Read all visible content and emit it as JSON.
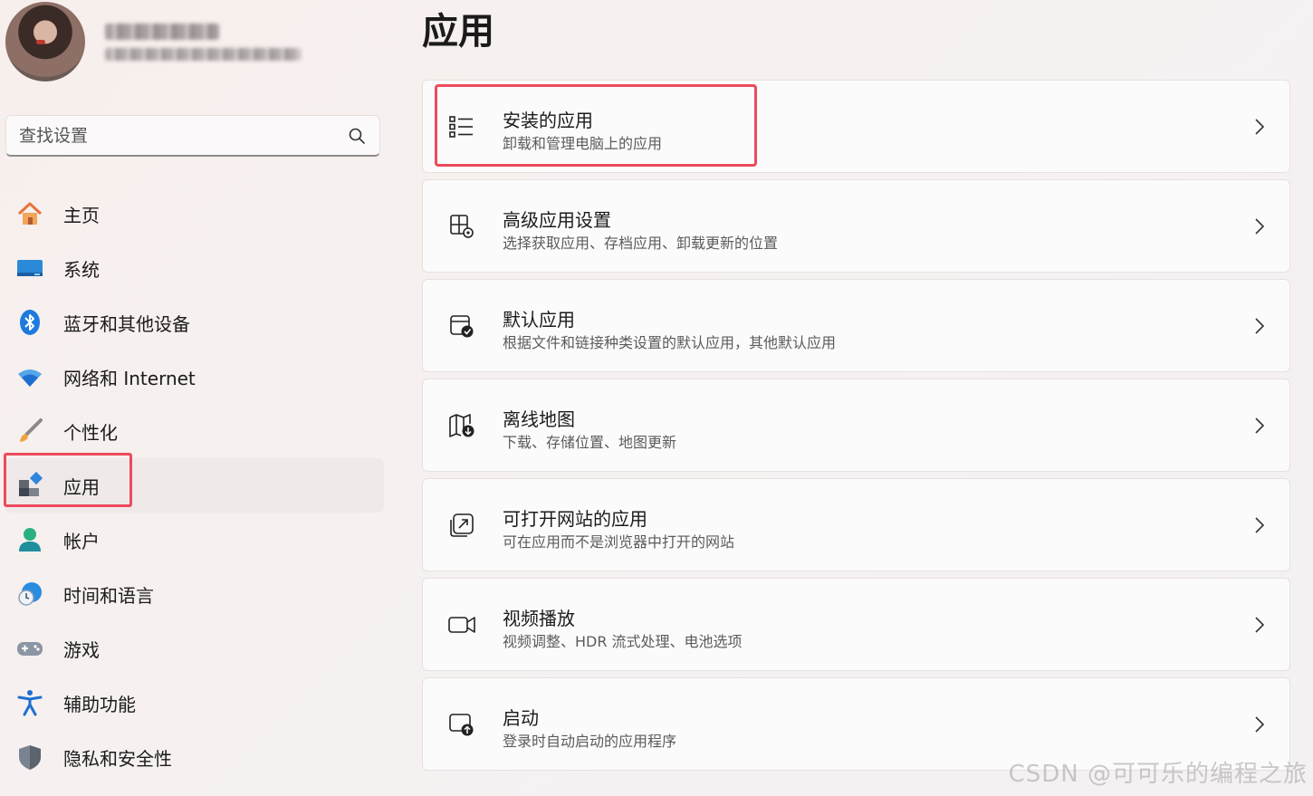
{
  "account": {
    "avatar_icon": "user-avatar-photo"
  },
  "search": {
    "placeholder": "查找设置",
    "icon": "search-icon"
  },
  "sidebar": {
    "items": [
      {
        "label": "主页",
        "icon": "home-icon"
      },
      {
        "label": "系统",
        "icon": "display-icon"
      },
      {
        "label": "蓝牙和其他设备",
        "icon": "bluetooth-icon"
      },
      {
        "label": "网络和 Internet",
        "icon": "wifi-icon"
      },
      {
        "label": "个性化",
        "icon": "brush-icon"
      },
      {
        "label": "应用",
        "icon": "apps-icon",
        "selected": true
      },
      {
        "label": "帐户",
        "icon": "account-icon"
      },
      {
        "label": "时间和语言",
        "icon": "time-language-icon"
      },
      {
        "label": "游戏",
        "icon": "gamepad-icon"
      },
      {
        "label": "辅助功能",
        "icon": "accessibility-icon"
      },
      {
        "label": "隐私和安全性",
        "icon": "shield-icon"
      }
    ]
  },
  "main": {
    "title": "应用",
    "cards": [
      {
        "title": "安装的应用",
        "desc": "卸载和管理电脑上的应用",
        "icon": "installed-apps-list-icon"
      },
      {
        "title": "高级应用设置",
        "desc": "选择获取应用、存档应用、卸载更新的位置",
        "icon": "advanced-app-settings-icon"
      },
      {
        "title": "默认应用",
        "desc": "根据文件和链接种类设置的默认应用，其他默认应用",
        "icon": "default-apps-icon"
      },
      {
        "title": "离线地图",
        "desc": "下载、存储位置、地图更新",
        "icon": "offline-maps-icon"
      },
      {
        "title": "可打开网站的应用",
        "desc": "可在应用而不是浏览器中打开的网站",
        "icon": "apps-for-websites-icon"
      },
      {
        "title": "视频播放",
        "desc": "视频调整、HDR 流式处理、电池选项",
        "icon": "video-camera-icon"
      },
      {
        "title": "启动",
        "desc": "登录时自动启动的应用程序",
        "icon": "startup-icon"
      }
    ]
  },
  "watermark": "CSDN @可可乐的编程之旅",
  "colors": {
    "highlight": "#ec4b5b",
    "accent": "#0067c0"
  }
}
